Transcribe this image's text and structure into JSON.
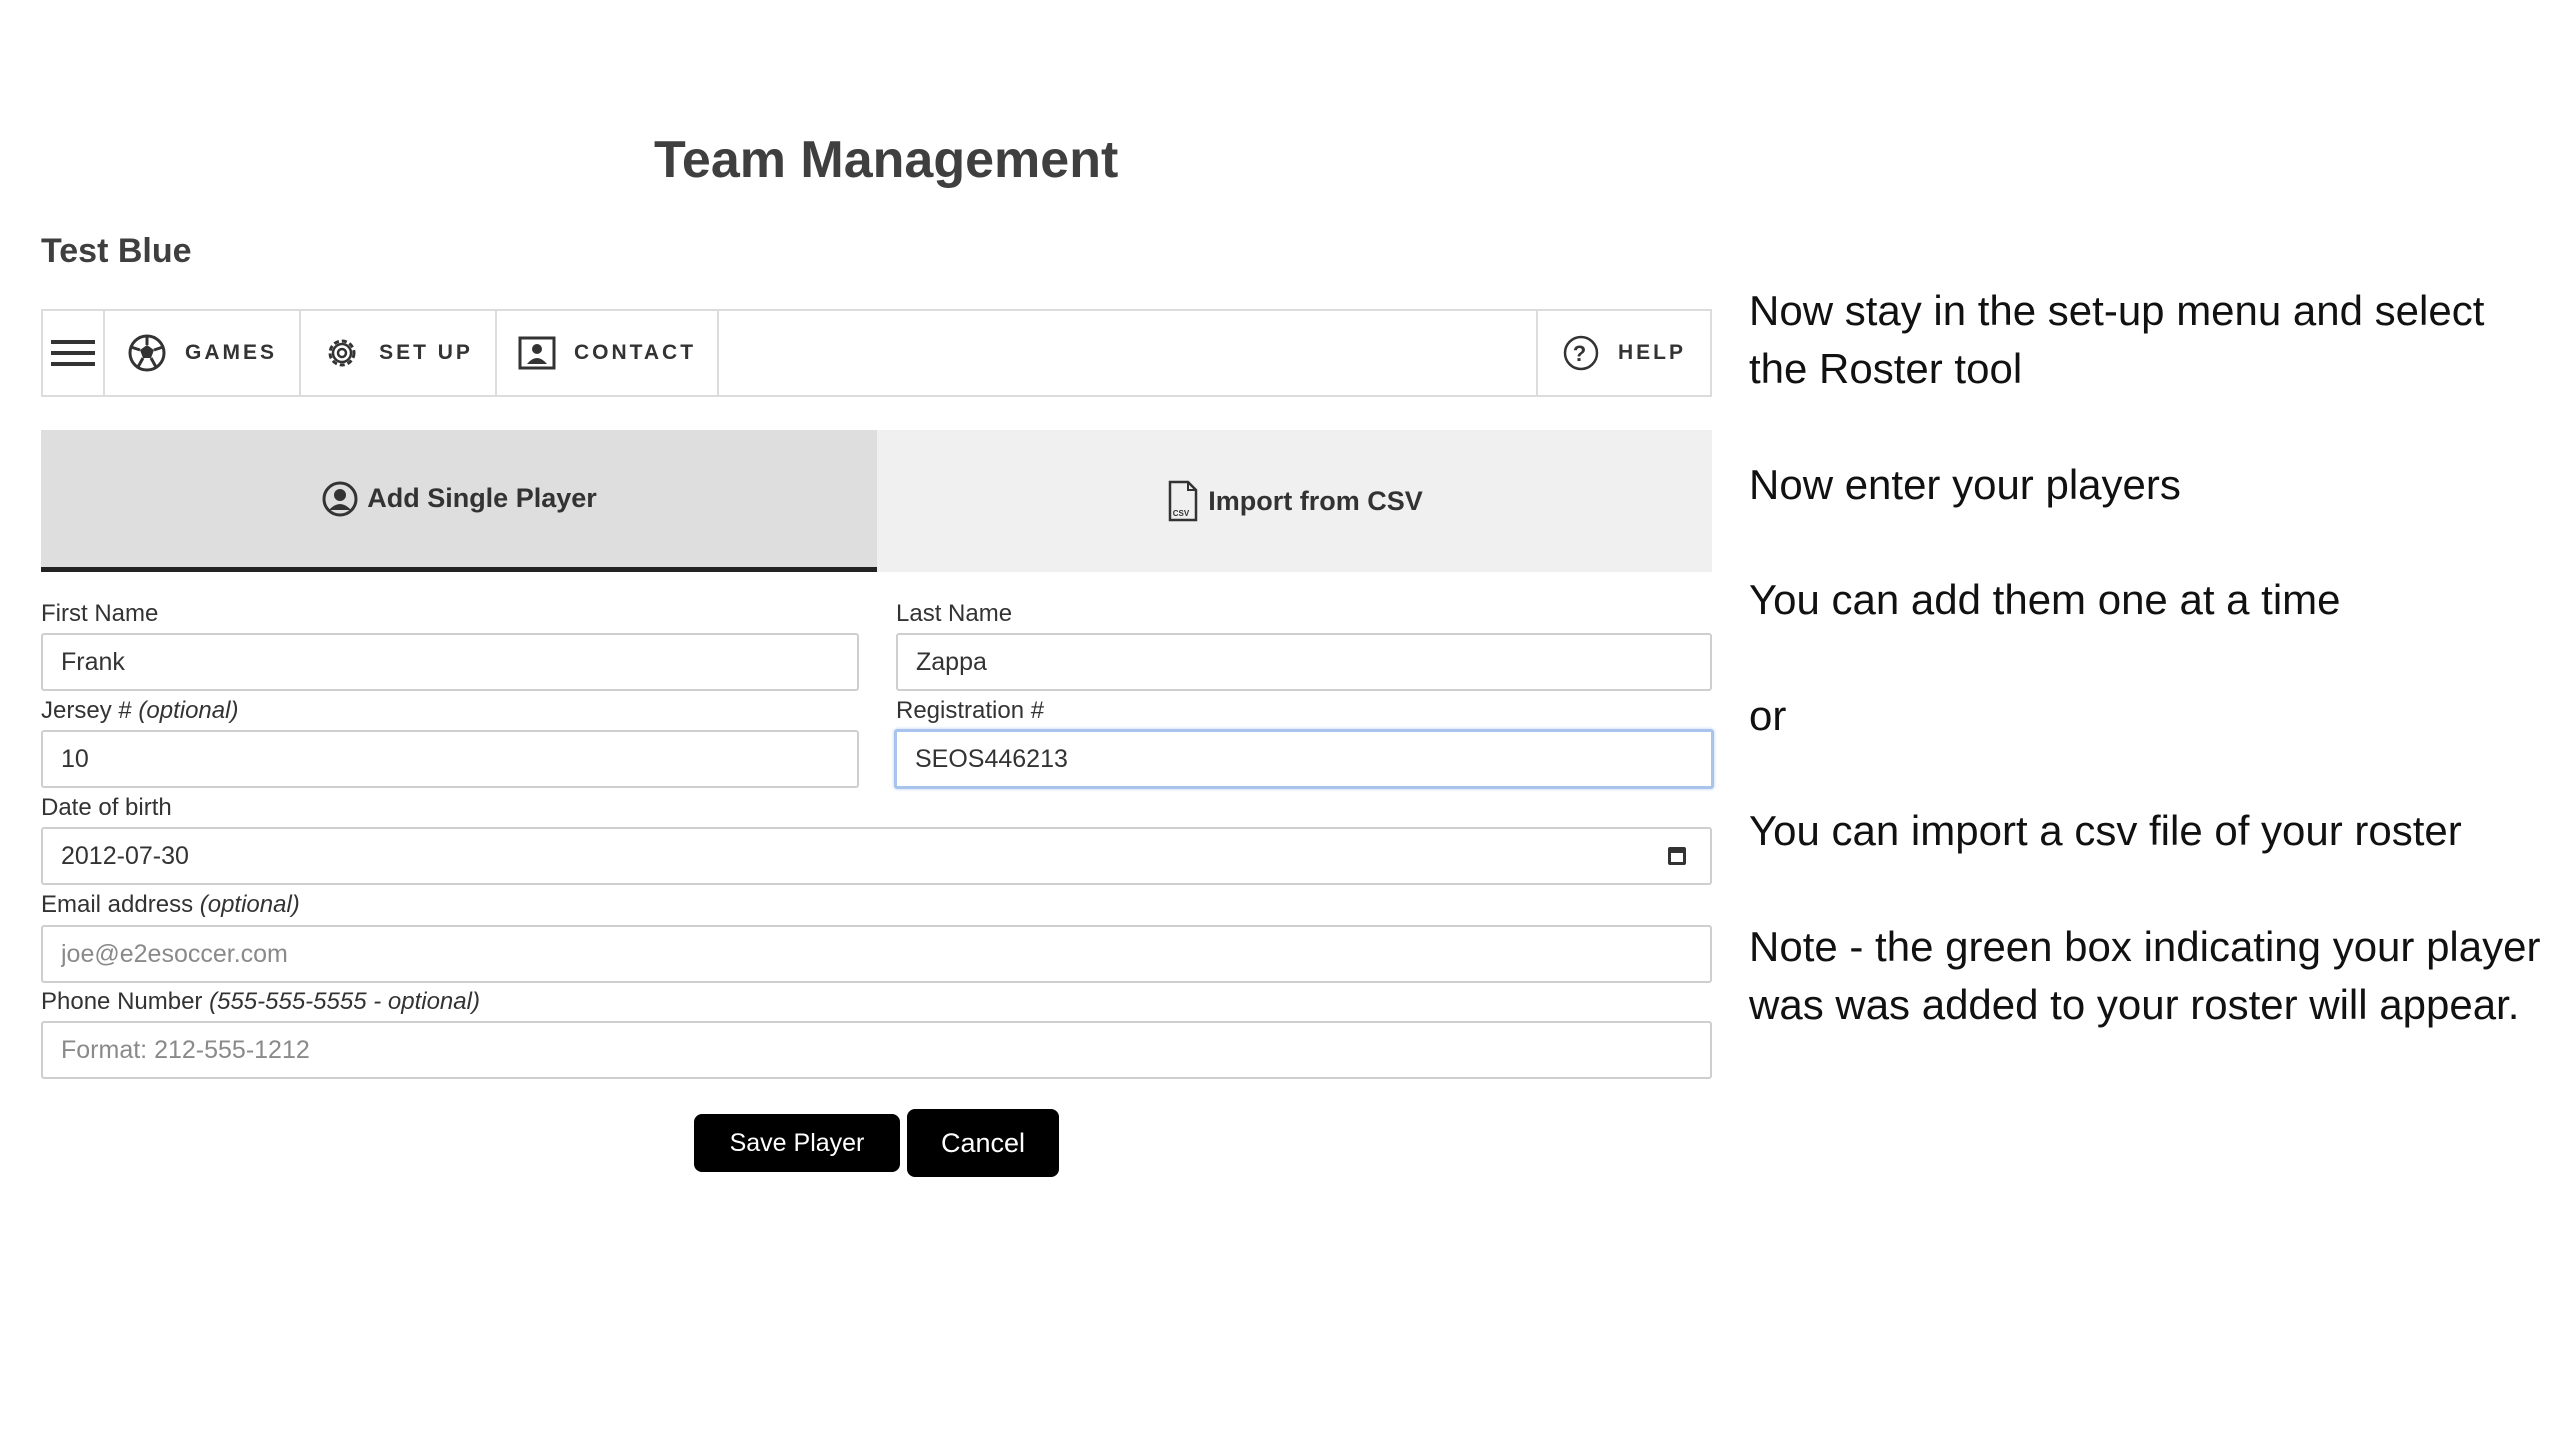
{
  "page": {
    "title": "Team Management",
    "team_name": "Test Blue"
  },
  "toolbar": {
    "games_label": "GAMES",
    "setup_label": "SET UP",
    "contact_label": "CONTACT",
    "help_label": "HELP",
    "icons": [
      "menu-icon",
      "soccer-ball-icon",
      "gear-icon",
      "contact-card-icon",
      "help-circle-icon"
    ]
  },
  "tabs": {
    "single_label": "Add Single Player",
    "csv_label": "Import from CSV",
    "active": "Add Single Player",
    "csv_icon_text": "CSV"
  },
  "form": {
    "first_name_label": "First Name",
    "first_name_value": "Frank",
    "last_name_label": "Last Name",
    "last_name_value": "Zappa",
    "jersey_label": "Jersey #",
    "jersey_optional": "(optional)",
    "jersey_value": "10",
    "registration_label": "Registration #",
    "registration_value": "SEOS446213",
    "dob_label": "Date of birth",
    "dob_value": "2012-07-30",
    "email_label": "Email address",
    "email_optional": "(optional)",
    "email_placeholder": "joe@e2esoccer.com",
    "phone_label": "Phone Number",
    "phone_optional": "(555-555-5555 - optional)",
    "phone_placeholder": "Format: 212-555-1212"
  },
  "buttons": {
    "save_label": "Save Player",
    "cancel_label": "Cancel"
  },
  "annotations": [
    "Now stay in the set-up menu and select the Roster tool",
    "Now enter your players",
    "You can add them one at a time",
    "or",
    "You can import a csv file of your roster",
    "Note - the green box indicating your player was was added to your roster will appear."
  ],
  "colors": {
    "button_bg": "#000000",
    "active_tab_bg": "#dedede",
    "focus_border": "#a9c4ec"
  }
}
